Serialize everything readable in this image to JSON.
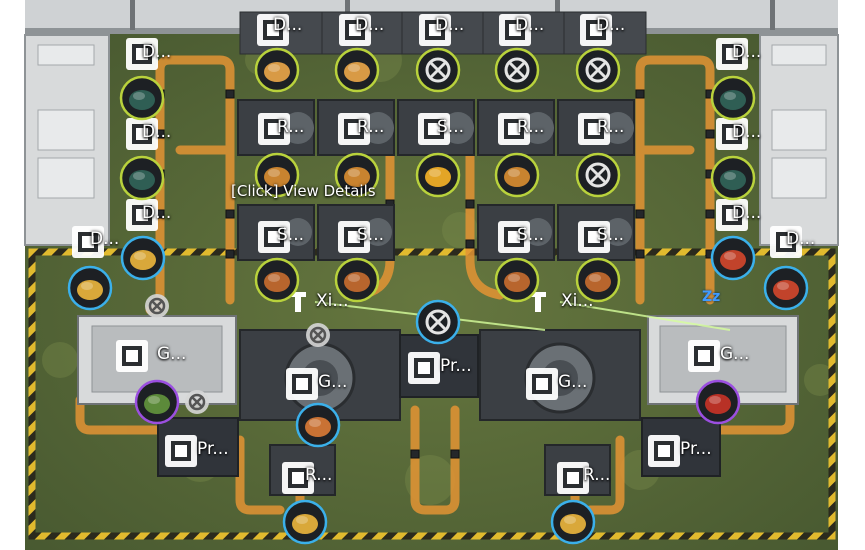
{
  "tooltip": "[Click] View Details",
  "sleep_indicator": "Zz",
  "icons": {
    "depot": "depot-icon",
    "refining": "refining-unit-icon",
    "shredding": "shredding-unit-icon",
    "gearing": "gearing-unit-icon",
    "protocol": "protocol-stash-icon",
    "guard": "guard-gate-icon",
    "relay": "relay-tower-icon",
    "idle": "idle-slot-icon",
    "item": "item-bubble-icon"
  },
  "colors": {
    "conveyor": "#e39434",
    "ground": "#56673a",
    "hazard": "#e1ba2e",
    "ring_yellow": "#b9d23c",
    "ring_blue": "#3bb0ea",
    "ring_purple": "#9b4fe0",
    "building_dark": "#3b3f44",
    "building_light": "#d8dadb"
  },
  "labels": {
    "depot_top_1": "D...",
    "depot_top_2": "D...",
    "depot_top_3": "D...",
    "depot_top_4": "D...",
    "depot_top_5": "D...",
    "depot_left_1": "D...",
    "depot_left_2": "D...",
    "depot_left_3": "D...",
    "depot_left_4": "D...",
    "depot_right_1": "D...",
    "depot_right_2": "D...",
    "depot_right_3": "D...",
    "depot_right_4": "D...",
    "refine_1": "R...",
    "refine_2": "R...",
    "refine_3": "R...",
    "refine_4": "R...",
    "refine_bottom_1": "R...",
    "refine_bottom_2": "R...",
    "shred_top": "S...",
    "shred_1": "S...",
    "shred_2": "S...",
    "shred_3": "S...",
    "shred_4": "S...",
    "relay_1": "Xi...",
    "relay_2": "Xi...",
    "guard_left": "G...",
    "guard_right": "G...",
    "gear_1": "G...",
    "gear_2": "G...",
    "protocol_center": "Pr...",
    "protocol_left": "Pr...",
    "protocol_right": "Pr..."
  },
  "slots": [
    {
      "ring": "yellow",
      "item": "ore-chunk"
    },
    {
      "ring": "yellow",
      "item": "ore-chunk"
    },
    {
      "ring": "yellow",
      "item": "empty"
    },
    {
      "ring": "yellow",
      "item": "empty"
    },
    {
      "ring": "yellow",
      "item": "empty"
    },
    {
      "ring": "yellow",
      "item": "green-ore"
    },
    {
      "ring": "yellow",
      "item": "green-ore"
    },
    {
      "ring": "yellow",
      "item": "green-ore"
    },
    {
      "ring": "yellow",
      "item": "green-ore"
    },
    {
      "ring": "yellow",
      "item": "amber-shard"
    },
    {
      "ring": "yellow",
      "item": "amber-shard"
    },
    {
      "ring": "yellow",
      "item": "gold-powder"
    },
    {
      "ring": "yellow",
      "item": "amber-shard"
    },
    {
      "ring": "yellow",
      "item": "empty"
    },
    {
      "ring": "yellow",
      "item": "copper-ingot"
    },
    {
      "ring": "yellow",
      "item": "copper-ingot"
    },
    {
      "ring": "yellow",
      "item": "copper-ingot"
    },
    {
      "ring": "yellow",
      "item": "copper-ingot"
    },
    {
      "ring": "blue",
      "item": "gold-crate"
    },
    {
      "ring": "blue",
      "item": "gold-crate"
    },
    {
      "ring": "blue",
      "item": "red-canister"
    },
    {
      "ring": "blue",
      "item": "red-canister"
    },
    {
      "ring": "blue",
      "item": "copper-block"
    },
    {
      "ring": "blue",
      "item": "empty"
    },
    {
      "ring": "blue",
      "item": "gold-crate"
    },
    {
      "ring": "blue",
      "item": "gold-crate"
    },
    {
      "ring": "purple",
      "item": "green-dome"
    },
    {
      "ring": "purple",
      "item": "red-dome"
    }
  ]
}
